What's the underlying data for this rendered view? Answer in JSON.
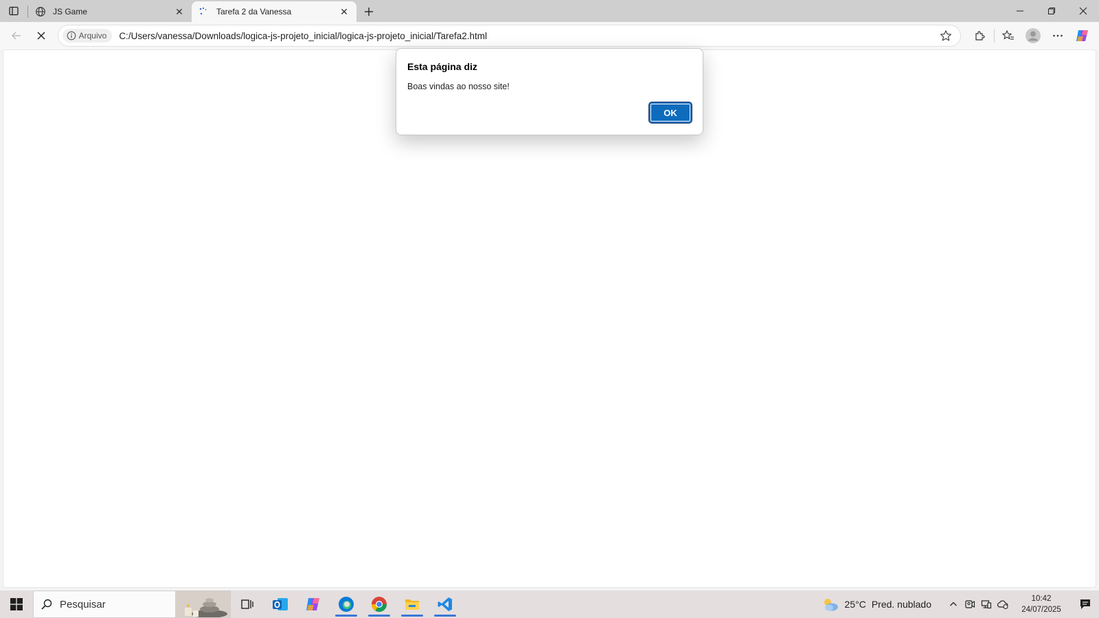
{
  "browser": {
    "tabs": [
      {
        "title": "JS Game",
        "icon": "globe-icon",
        "active": false
      },
      {
        "title": "Tarefa 2 da Vanessa",
        "icon": "loading-spinner-icon",
        "active": true
      }
    ],
    "address": {
      "chip_label": "Arquivo",
      "url": "C:/Users/vanessa/Downloads/logica-js-projeto_inicial/logica-js-projeto_inicial/Tarefa2.html"
    }
  },
  "dialog": {
    "title": "Esta página diz",
    "message": "Boas vindas ao nosso site!",
    "ok_label": "OK"
  },
  "taskbar": {
    "search_placeholder": "Pesquisar",
    "apps": [
      "task-view",
      "outlook",
      "copilot",
      "edge",
      "chrome",
      "file-explorer",
      "vscode"
    ],
    "weather": {
      "temp": "25°C",
      "condition": "Pred. nublado"
    },
    "clock": {
      "time": "10:42",
      "date": "24/07/2025"
    }
  },
  "colors": {
    "accent": "#0f6cbd",
    "tabstrip": "#cfcfcf",
    "taskbar": "#e4dedf"
  }
}
